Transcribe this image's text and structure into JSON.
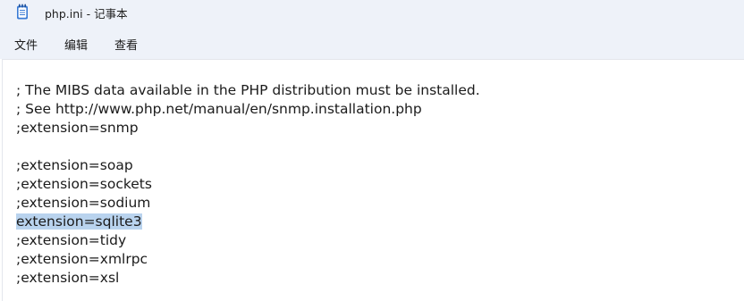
{
  "window": {
    "title": "php.ini - 记事本",
    "icon": "notepad-icon"
  },
  "menu": {
    "file": "文件",
    "edit": "编辑",
    "view": "查看"
  },
  "editor": {
    "lines": [
      "; The MIBS data available in the PHP distribution must be installed.",
      "; See http://www.php.net/manual/en/snmp.installation.php",
      ";extension=snmp",
      "",
      ";extension=soap",
      ";extension=sockets",
      ";extension=sodium",
      "extension=sqlite3",
      ";extension=tidy",
      ";extension=xmlrpc",
      ";extension=xsl"
    ],
    "selected_line_index": 7,
    "selection_color": "#b9d3ee"
  }
}
